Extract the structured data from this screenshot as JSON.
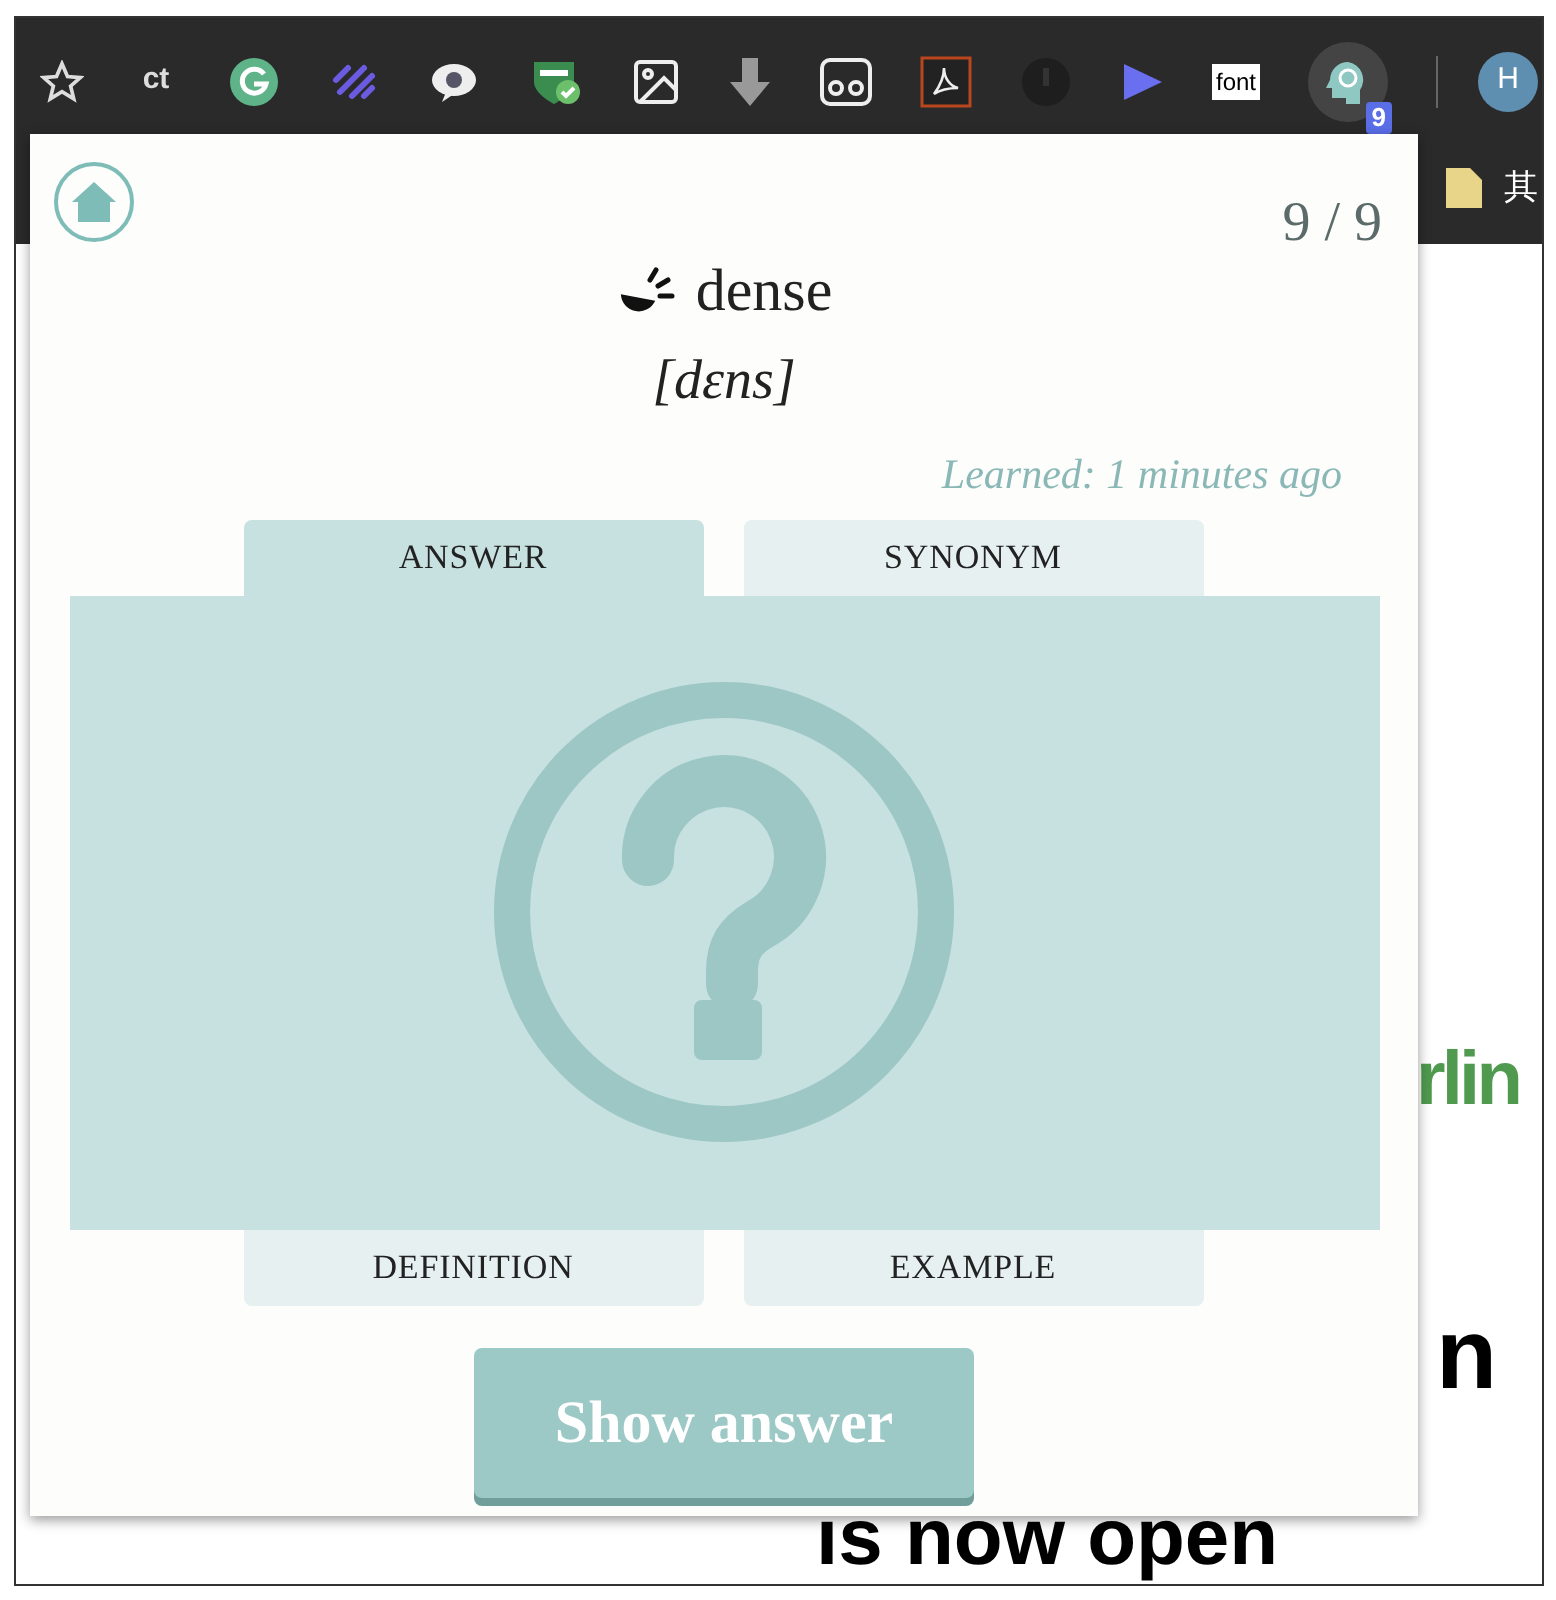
{
  "toolbar": {
    "icons": [
      {
        "kind": "star"
      },
      {
        "kind": "text",
        "label": "ct"
      },
      {
        "kind": "grammar"
      },
      {
        "kind": "stripes"
      },
      {
        "kind": "chat"
      },
      {
        "kind": "shield"
      },
      {
        "kind": "image"
      },
      {
        "kind": "download"
      },
      {
        "kind": "cassette"
      },
      {
        "kind": "pdf"
      },
      {
        "kind": "dark"
      },
      {
        "kind": "play"
      },
      {
        "kind": "box",
        "label": "font"
      },
      {
        "kind": "brain",
        "badge": "9"
      },
      {
        "kind": "avatar",
        "label": "H"
      }
    ]
  },
  "bookmarks": {
    "folder": "其"
  },
  "background_page": {
    "fragments": [
      {
        "kind": "green",
        "text": "rlin"
      },
      {
        "kind": "black",
        "text": "n"
      },
      {
        "kind": "black",
        "text": "is now open"
      }
    ]
  },
  "popup": {
    "counter": "9 / 9",
    "word": "dense",
    "pronunciation": "[dɛns]",
    "learned": "Learned: 1 minutes ago",
    "top_tabs": [
      {
        "label": "ANSWER",
        "selected": true
      },
      {
        "label": "SYNONYM",
        "selected": false
      }
    ],
    "bottom_tabs": [
      {
        "label": "DEFINITION",
        "selected": false
      },
      {
        "label": "EXAMPLE",
        "selected": false
      }
    ],
    "button": "Show answer"
  }
}
